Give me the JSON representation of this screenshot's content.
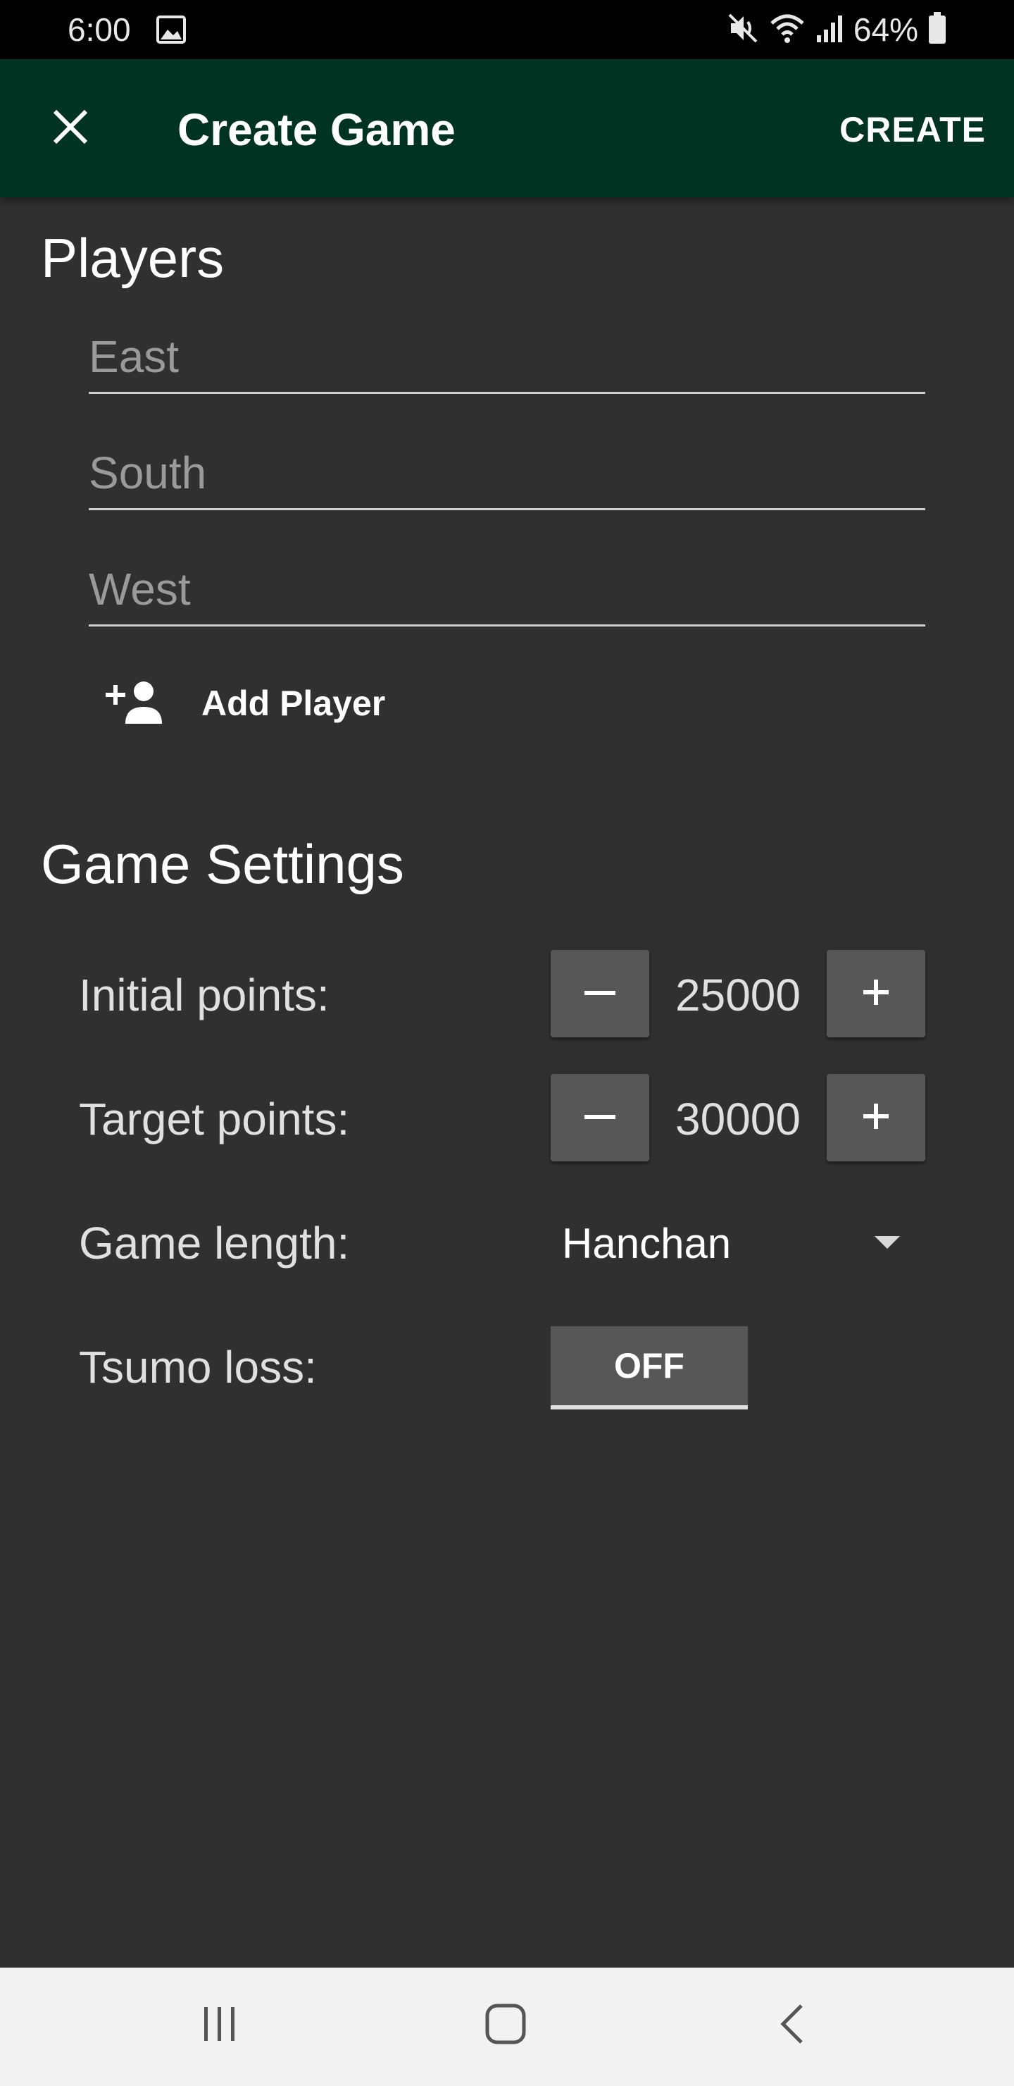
{
  "status_bar": {
    "time": "6:00",
    "battery_text": "64%",
    "icons": [
      "gallery-icon",
      "mute-icon",
      "wifi-icon",
      "signal-icon",
      "battery-icon"
    ]
  },
  "app_bar": {
    "close_icon": "close-icon",
    "title": "Create Game",
    "create_label": "CREATE",
    "background_color": "#003322"
  },
  "players": {
    "heading": "Players",
    "inputs": [
      {
        "value": "",
        "placeholder": "East"
      },
      {
        "value": "",
        "placeholder": "South"
      },
      {
        "value": "",
        "placeholder": "West"
      }
    ],
    "add_player_icon": "person-add-icon",
    "add_player_label": "Add Player"
  },
  "game_settings": {
    "heading": "Game Settings",
    "initial_points": {
      "label": "Initial points:",
      "value": "25000"
    },
    "target_points": {
      "label": "Target points:",
      "value": "30000"
    },
    "game_length": {
      "label": "Game length:",
      "value": "Hanchan"
    },
    "tsumo_loss": {
      "label": "Tsumo loss:",
      "state": "OFF"
    }
  },
  "nav_bar": {
    "icons": [
      "recent-apps-icon",
      "home-icon",
      "back-icon"
    ]
  }
}
